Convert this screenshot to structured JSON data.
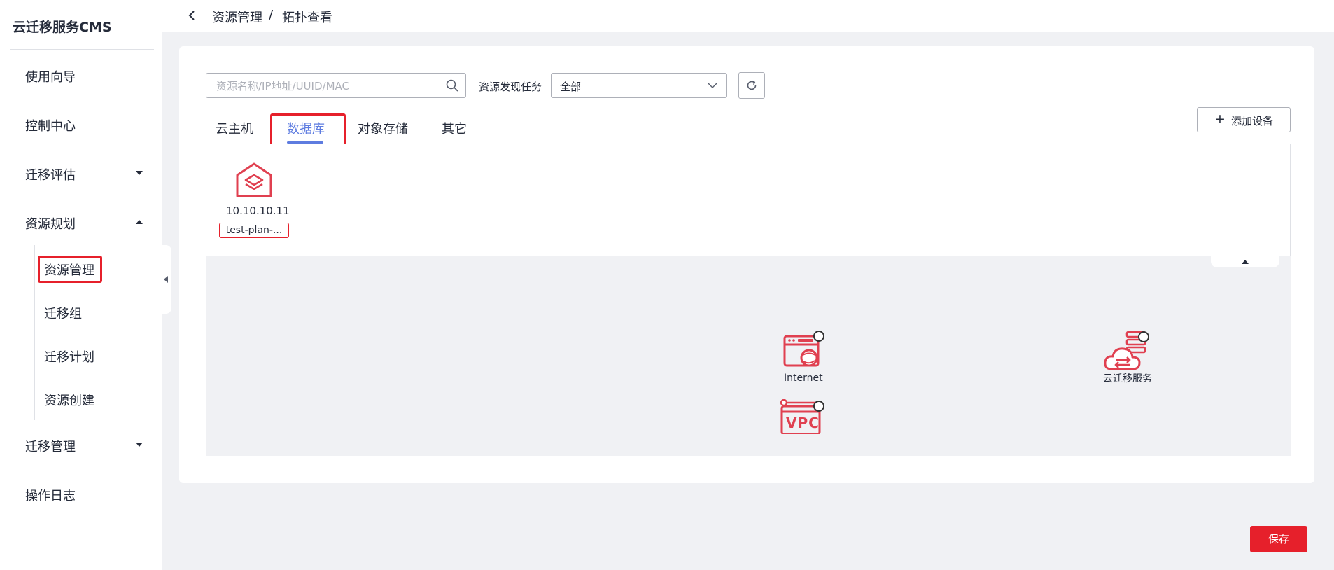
{
  "app": {
    "title": "云迁移服务CMS"
  },
  "sidebar": {
    "items": [
      {
        "label": "使用向导"
      },
      {
        "label": "控制中心"
      },
      {
        "label": "迁移评估"
      },
      {
        "label": "资源规划"
      },
      {
        "label": "迁移管理"
      },
      {
        "label": "操作日志"
      }
    ],
    "sub_items": [
      {
        "label": "资源管理"
      },
      {
        "label": "迁移组"
      },
      {
        "label": "迁移计划"
      },
      {
        "label": "资源创建"
      }
    ]
  },
  "breadcrumb": {
    "parent": "资源管理",
    "separator": "/",
    "current": "拓扑查看"
  },
  "search": {
    "placeholder": "资源名称/IP地址/UUID/MAC",
    "value": ""
  },
  "filter": {
    "label": "资源发现任务",
    "selected": "全部"
  },
  "tabs": [
    {
      "label": "云主机"
    },
    {
      "label": "数据库"
    },
    {
      "label": "对象存储"
    },
    {
      "label": "其它"
    }
  ],
  "active_tab": "数据库",
  "add_device": {
    "label": "添加设备"
  },
  "resources": [
    {
      "ip": "10.10.10.11",
      "name": "test-plan-..."
    }
  ],
  "topology": {
    "nodes": [
      {
        "label": "Internet"
      },
      {
        "label": "云迁移服务"
      },
      {
        "label": "VPC"
      }
    ]
  },
  "save": {
    "label": "保存"
  },
  "colors": {
    "accent": "#5e7ce0",
    "danger": "#e6202b",
    "icon_red": "#e04050"
  }
}
